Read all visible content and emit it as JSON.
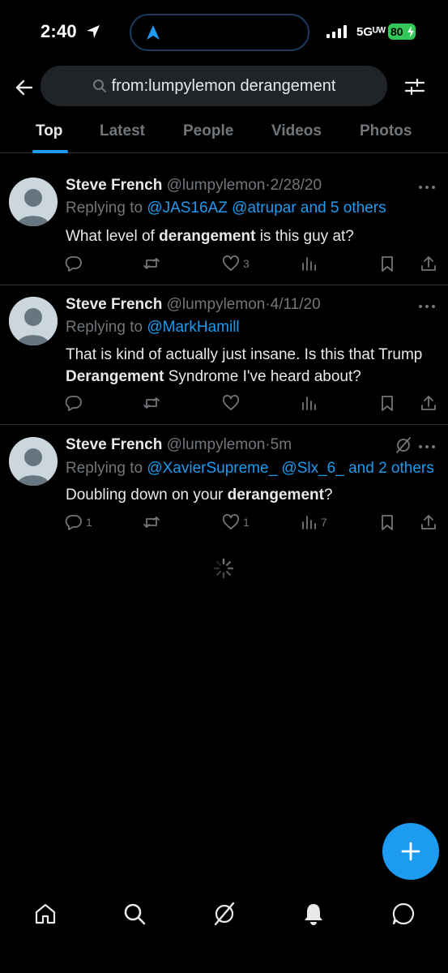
{
  "status_bar": {
    "time": "2:40",
    "network": "5Gᵁᵂ",
    "battery": "80"
  },
  "search": {
    "query": "from:lumpylemon derangement"
  },
  "tabs": [
    {
      "label": "Top",
      "active": true
    },
    {
      "label": "Latest",
      "active": false
    },
    {
      "label": "People",
      "active": false
    },
    {
      "label": "Videos",
      "active": false
    },
    {
      "label": "Photos",
      "active": false
    }
  ],
  "tweets": [
    {
      "name": "Steve French",
      "handle": "@lumpylemon",
      "time": "2/28/20",
      "replying_prefix": "Replying to ",
      "replying_mentions": "@JAS16AZ @atrupar and 5 others",
      "body_before": "What level of ",
      "body_bold": "derangement",
      "body_after": " is this guy at?",
      "replies": "",
      "retweets": "",
      "likes": "3",
      "views": ""
    },
    {
      "name": "Steve French",
      "handle": "@lumpylemon",
      "time": "4/11/20",
      "replying_prefix": "Replying to ",
      "replying_mentions": "@MarkHamill",
      "body_before": "That is kind of actually just insane. Is this that Trump ",
      "body_bold": "Derangement",
      "body_after": " Syndrome I've heard about?",
      "replies": "",
      "retweets": "",
      "likes": "",
      "views": ""
    },
    {
      "name": "Steve French",
      "handle": "@lumpylemon",
      "time": "5m",
      "replying_prefix": "Replying to ",
      "replying_mentions": "@XavierSupreme_ @Slx_6_ and 2 others",
      "body_before": "Doubling down on your ",
      "body_bold": "derangement",
      "body_after": "?",
      "replies": "1",
      "retweets": "",
      "likes": "1",
      "views": "7"
    }
  ],
  "icons": {
    "back": "back-arrow-icon",
    "search": "search-icon",
    "filter": "filter-sliders-icon",
    "reply": "reply-bubble-icon",
    "retweet": "retweet-icon",
    "like": "heart-icon",
    "views": "views-bar-chart-icon",
    "bookmark": "bookmark-icon",
    "share": "share-icon",
    "more": "more-dots-icon",
    "grok": "grok-icon",
    "compose": "plus-icon",
    "nav": [
      "home-icon",
      "search-icon",
      "grok-icon",
      "bell-icon",
      "message-icon"
    ]
  },
  "colors": {
    "accent": "#1d9bf0",
    "background": "#000000",
    "muted": "#71767b",
    "text": "#e7e9ea",
    "battery": "#34c759"
  }
}
